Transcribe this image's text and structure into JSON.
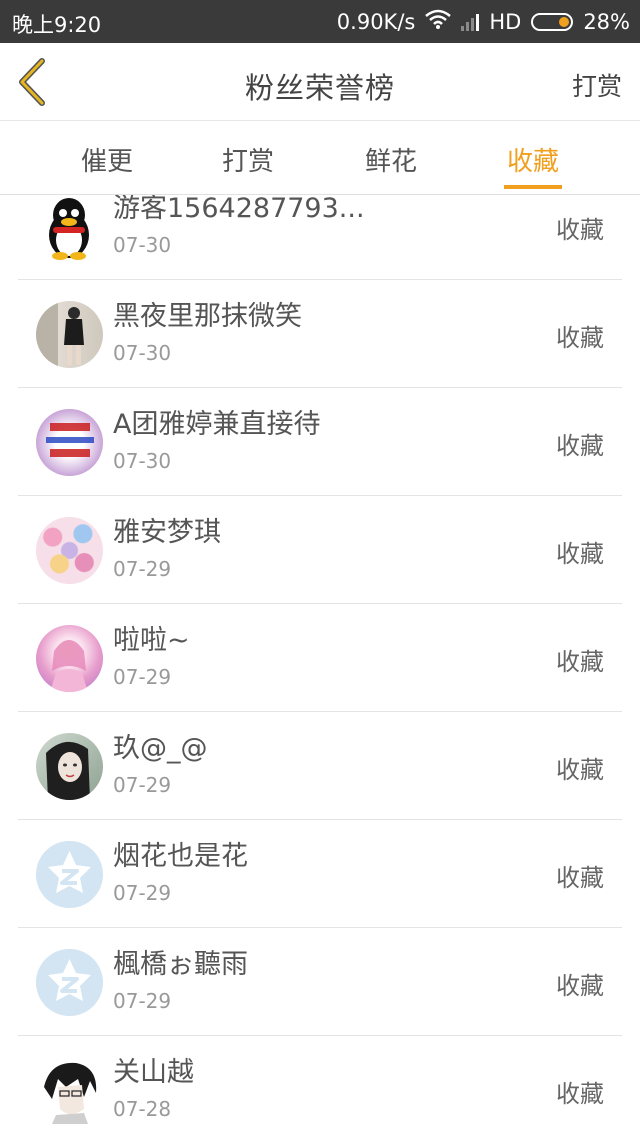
{
  "status_bar": {
    "time": "晚上9:20",
    "speed": "0.90K/s",
    "network": "HD",
    "battery": "28%",
    "battery_level": 0.28,
    "accent": "#f0a01e"
  },
  "header": {
    "title": "粉丝荣誉榜",
    "action_label": "打赏",
    "back_icon": "chevron-left-icon",
    "icon_color": "#d4a017"
  },
  "tabs": [
    {
      "label": "催更",
      "active": false
    },
    {
      "label": "打赏",
      "active": false
    },
    {
      "label": "鲜花",
      "active": false
    },
    {
      "label": "收藏",
      "active": true
    }
  ],
  "rows": [
    {
      "name": "游客1564287793...",
      "date": "07-30",
      "type": "收藏",
      "avatar": "qq-penguin-avatar"
    },
    {
      "name": "黑夜里那抹微笑",
      "date": "07-30",
      "type": "收藏",
      "avatar": "photo-avatar"
    },
    {
      "name": "A团雅婷兼直接待",
      "date": "07-30",
      "type": "收藏",
      "avatar": "recruit-sign-avatar"
    },
    {
      "name": "雅安梦琪",
      "date": "07-29",
      "type": "收藏",
      "avatar": "anime-collage-avatar"
    },
    {
      "name": "啦啦~",
      "date": "07-29",
      "type": "收藏",
      "avatar": "anime-girl-avatar"
    },
    {
      "name": "玖@_@",
      "date": "07-29",
      "type": "收藏",
      "avatar": "girl-portrait-avatar"
    },
    {
      "name": "烟花也是花",
      "date": "07-29",
      "type": "收藏",
      "avatar": "default-z-avatar"
    },
    {
      "name": "楓橋ぉ聽雨",
      "date": "07-29",
      "type": "收藏",
      "avatar": "default-z-avatar"
    },
    {
      "name": "关山越",
      "date": "07-28",
      "type": "收藏",
      "avatar": "anime-boy-avatar"
    }
  ]
}
